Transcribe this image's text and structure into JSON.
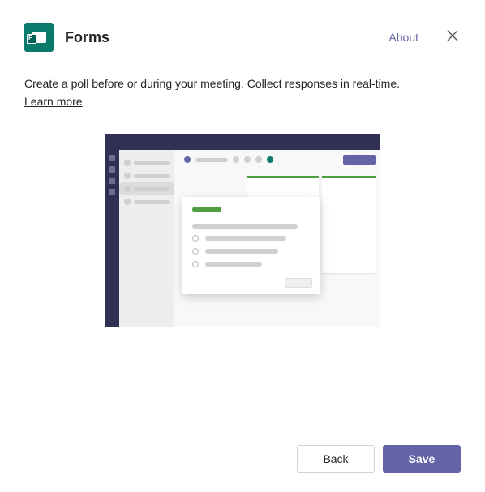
{
  "header": {
    "app_title": "Forms",
    "about_label": "About"
  },
  "description": {
    "text": "Create a poll before or during your meeting. Collect responses in real-time.",
    "learn_more_label": "Learn more"
  },
  "footer": {
    "back_label": "Back",
    "save_label": "Save"
  },
  "colors": {
    "brand_purple": "#6264a7",
    "forms_teal": "#0a7a6d",
    "poll_green": "#4d9e3f"
  }
}
